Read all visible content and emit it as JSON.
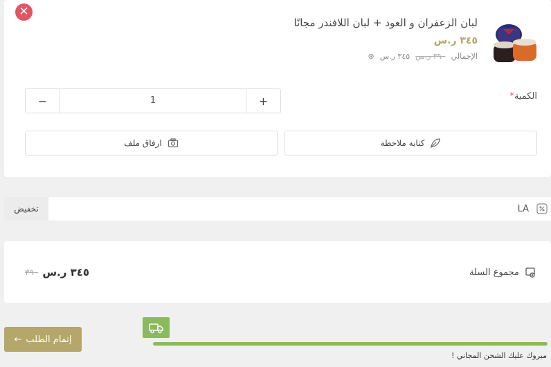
{
  "product": {
    "remove_icon": "close-icon",
    "title": "لبان الزعفران و العود + لبان اللافندر مجانًا",
    "price": "٣٤٥ ر.س",
    "total_label": "الإجمالي",
    "total_old": "٣٩٠ ر.س",
    "total_new": "٣٤٥ ر.س",
    "quantity_label": "الكمية",
    "quantity_required_mark": "*",
    "quantity_value": "1",
    "increase_label": "+",
    "decrease_label": "−",
    "note_button": "كتابة ملاحظة",
    "attach_button": "ارفاق ملف"
  },
  "coupon": {
    "value": "LA",
    "apply_label": "تخفيض"
  },
  "summary": {
    "label": "مجموع السلة",
    "old_total": "٣٩٠",
    "total": "٣٤٥ ر.س"
  },
  "checkout": {
    "label": "إتمام الطلب"
  },
  "shipping": {
    "progress": 1.0,
    "message": "مبروك عليك الشحن المجاني !"
  },
  "colors": {
    "accent": "#b5a66a",
    "danger": "#e25563",
    "success": "#8aba5a"
  }
}
